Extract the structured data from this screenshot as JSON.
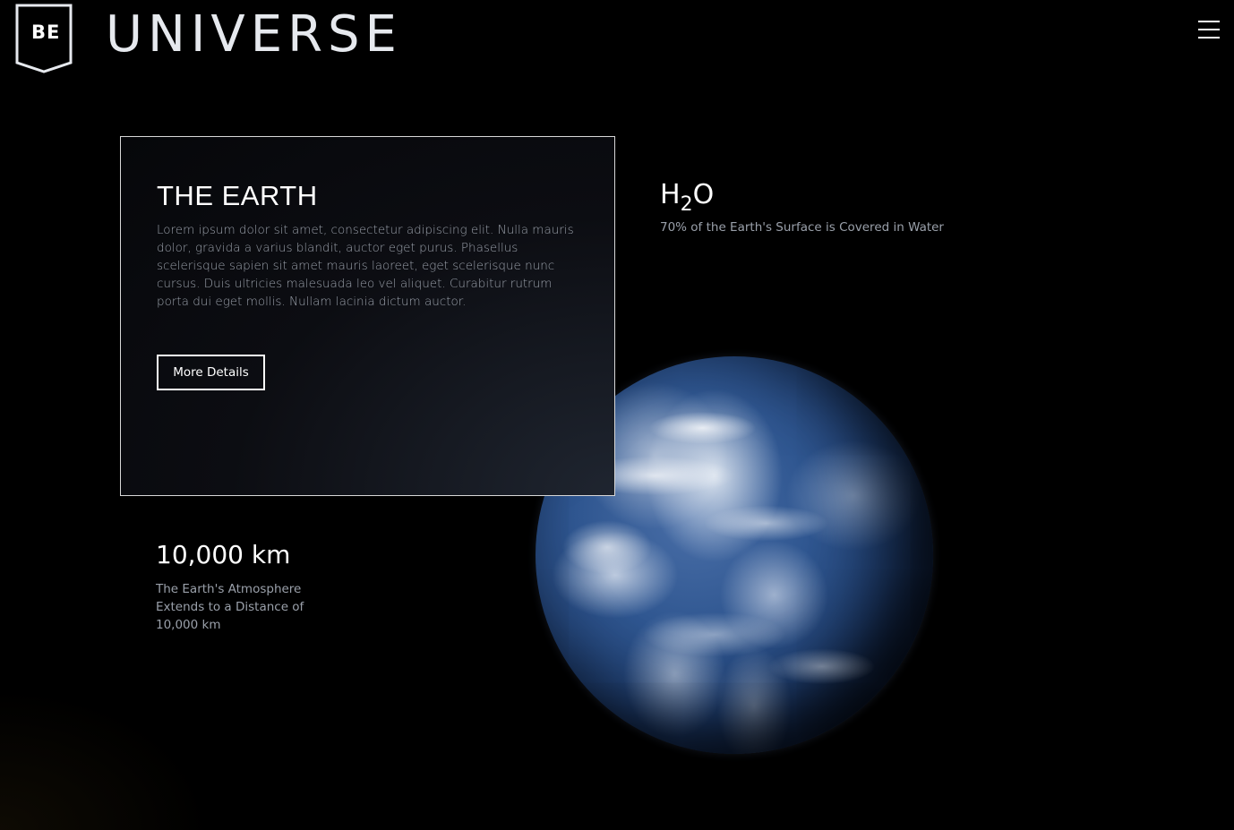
{
  "header": {
    "logo_text": "BE",
    "brand_title": "UNIVERSE"
  },
  "card": {
    "title": "THE EARTH",
    "body": "Lorem ipsum dolor sit amet, consectetur adipiscing elit. Nulla mauris dolor, gravida a varius blandit, auctor eget purus. Phasellus scelerisque sapien sit amet mauris laoreet, eget scelerisque nunc cursus. Duis ultricies malesuada leo vel aliquet. Curabitur rutrum porta dui eget mollis. Nullam lacinia dictum auctor.",
    "button_label": "More Details"
  },
  "water_stat": {
    "title_main": "H",
    "title_sub": "2",
    "title_end": "O",
    "description": "70% of the Earth's Surface is Covered in Water"
  },
  "atmosphere_stat": {
    "title": "10,000 km",
    "description": "The Earth's Atmosphere Extends to a Distance of 10,000 km"
  },
  "icons": {
    "menu": "hamburger-menu-icon",
    "logo": "shield-badge-icon",
    "globe": "earth-image"
  },
  "colors": {
    "background": "#000000",
    "text_primary": "#ffffff",
    "text_secondary": "#9aa0aa",
    "brand_title": "#e6e9ee"
  }
}
